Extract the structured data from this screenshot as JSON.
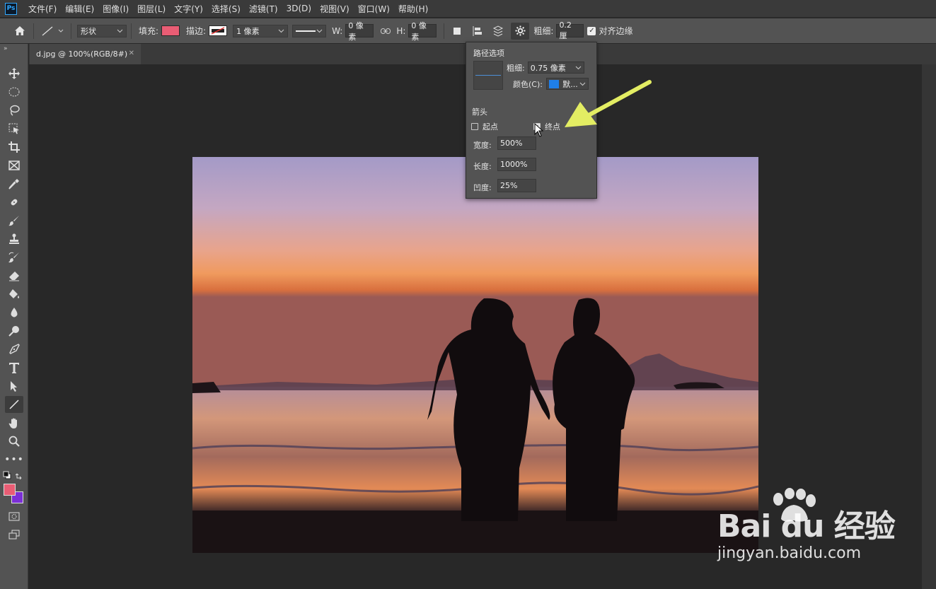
{
  "app": {
    "logo": "Ps"
  },
  "menu": [
    "文件(F)",
    "编辑(E)",
    "图像(I)",
    "图层(L)",
    "文字(Y)",
    "选择(S)",
    "滤镜(T)",
    "3D(D)",
    "视图(V)",
    "窗口(W)",
    "帮助(H)"
  ],
  "options": {
    "mode": "形状",
    "fill_label": "填充:",
    "fill_color": "#e95d74",
    "stroke_label": "描边:",
    "stroke_width": "1 像素",
    "w_label": "W:",
    "w_value": "0 像素",
    "h_label": "H:",
    "h_value": "0 像素",
    "weight_label": "粗细:",
    "weight_value": "0.2 厘",
    "align_edges_label": "对齐边缘"
  },
  "document": {
    "tab_title": "d.jpg @ 100%(RGB/8#)"
  },
  "colors": {
    "foreground": "#e95d74",
    "background": "#7b2fd6"
  },
  "path_options": {
    "title": "路径选项",
    "weight_label": "粗细:",
    "weight_value": "0.75 像素",
    "color_label": "颜色(C):",
    "color_value": "默...",
    "color_swatch": "#1f7fe8",
    "arrowheads_label": "箭头",
    "start_label": "起点",
    "start_checked": false,
    "end_label": "终点",
    "end_checked": true,
    "width_label": "宽度:",
    "width_value": "500%",
    "length_label": "长度:",
    "length_value": "1000%",
    "concavity_label": "凹度:",
    "concavity_value": "25%"
  },
  "watermark": {
    "brand": "Bai  du 经验",
    "site": "jingyan.baidu.com"
  }
}
